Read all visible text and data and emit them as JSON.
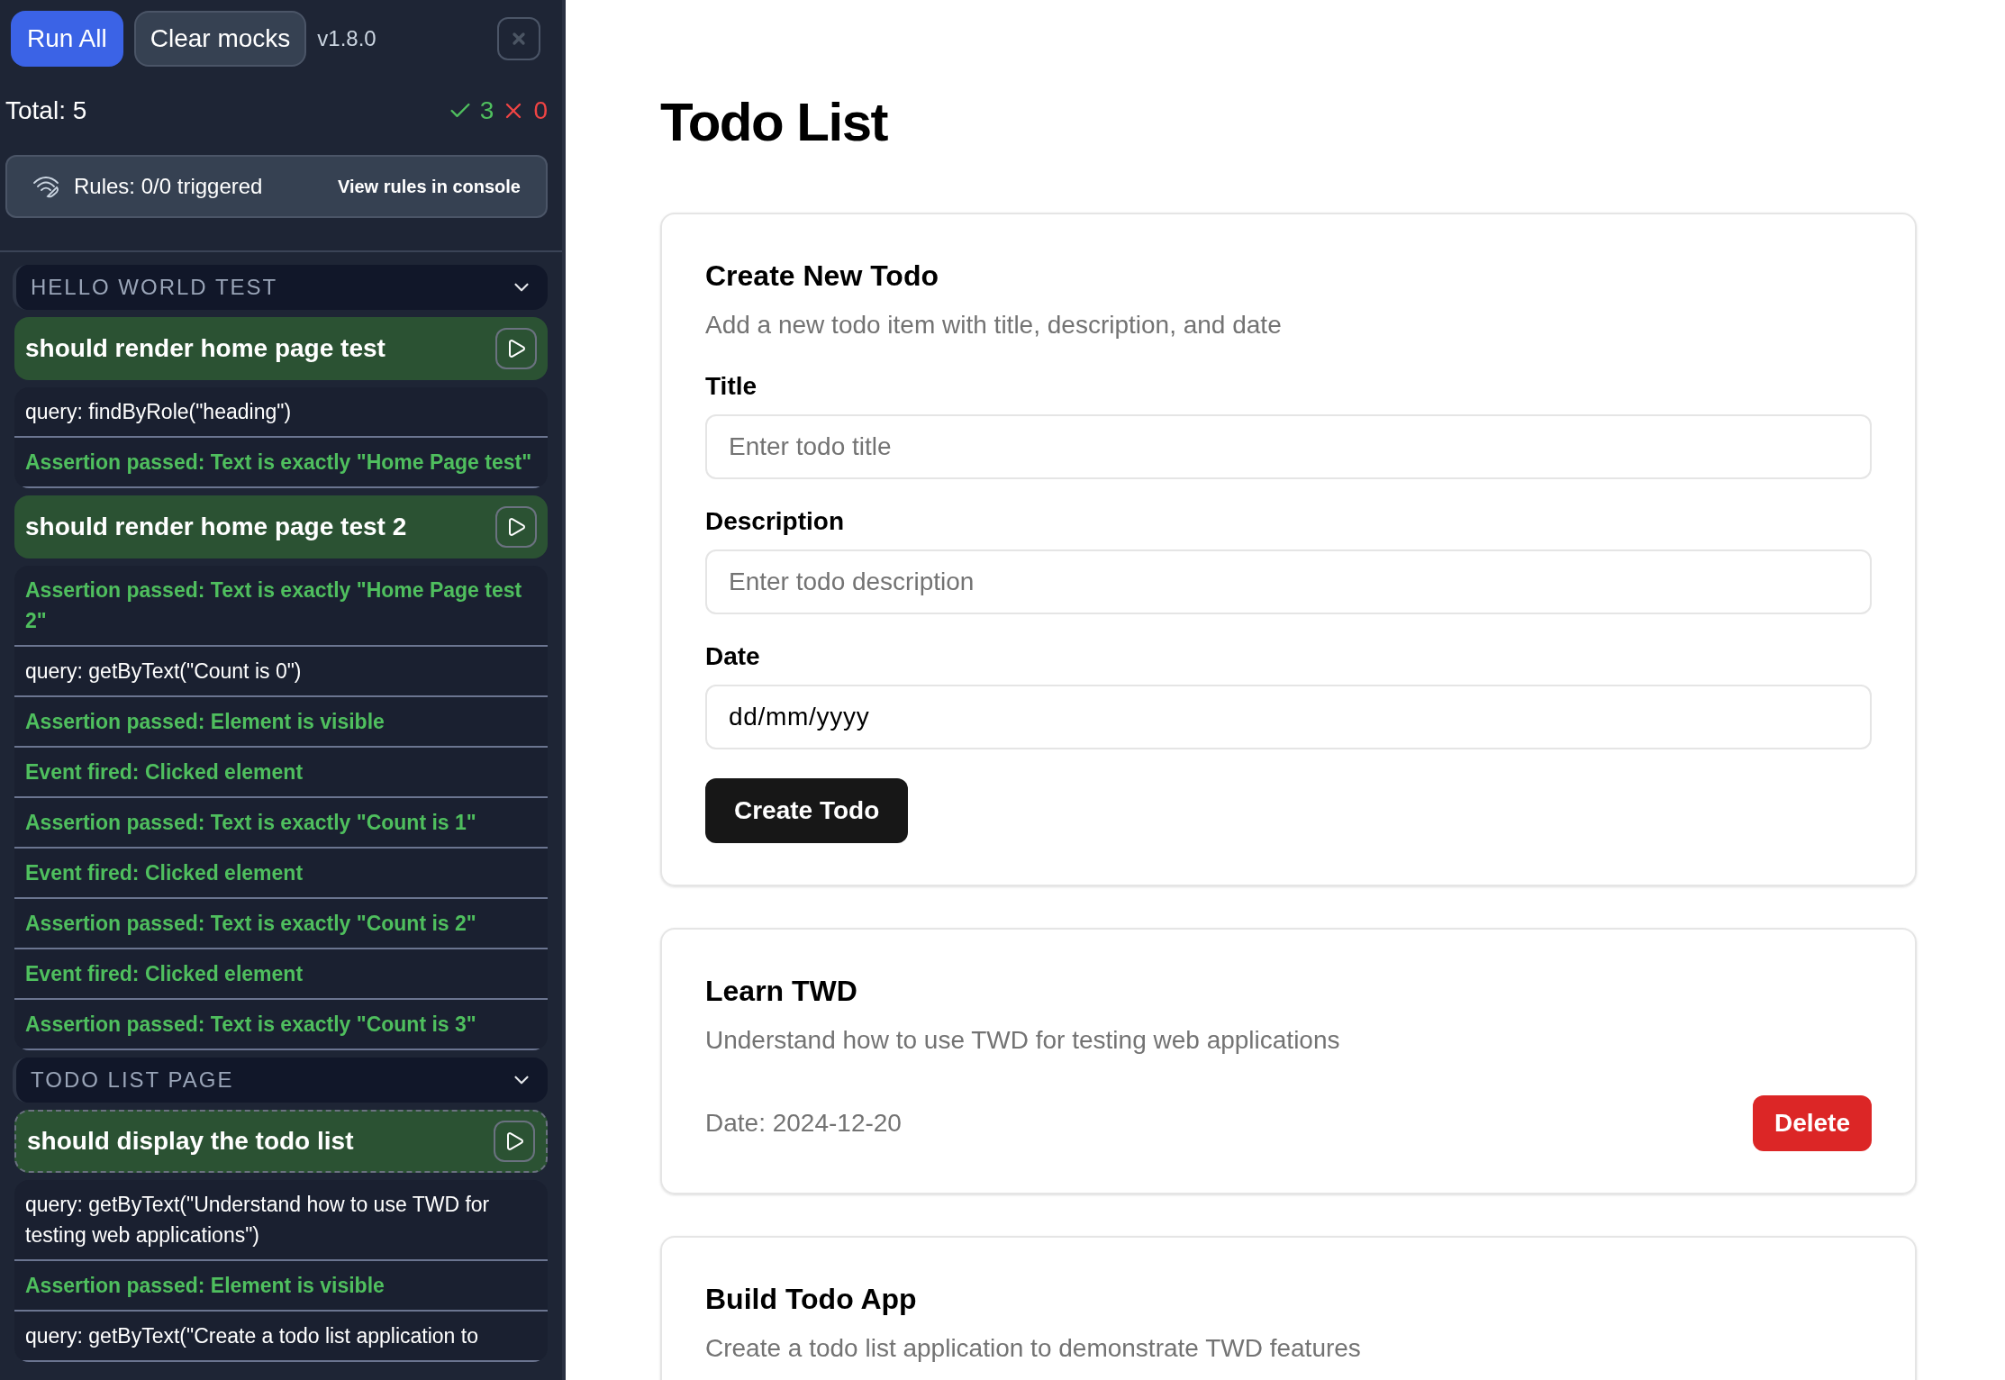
{
  "sidebar": {
    "buttons": [
      {
        "label": "Run All",
        "kind": "primary"
      },
      {
        "label": "Clear mocks",
        "kind": "secondary"
      }
    ],
    "version": "v1.8.0",
    "total": "Total: 5",
    "passed": "3",
    "failed": "0",
    "rules": {
      "label": "Rules: 0/0 triggered",
      "link": "View rules in console"
    },
    "groups": [
      {
        "title": "HELLO WORLD TEST",
        "expanded": true,
        "tests": [
          {
            "name": "should render home page test",
            "passed": true,
            "selected": false,
            "steps": [
              {
                "kind": "query",
                "text": "query: findByRole(\"heading\")"
              },
              {
                "kind": "assertion",
                "text": "Assertion passed: Text is exactly \"Home Page test\""
              }
            ]
          },
          {
            "name": "should render home page test 2",
            "passed": true,
            "selected": false,
            "steps": [
              {
                "kind": "assertion",
                "text": "Assertion passed: Text is exactly \"Home Page test 2\""
              },
              {
                "kind": "query",
                "text": "query: getByText(\"Count is 0\")"
              },
              {
                "kind": "assertion",
                "text": "Assertion passed: Element is visible"
              },
              {
                "kind": "event",
                "text": "Event fired: Clicked element"
              },
              {
                "kind": "assertion",
                "text": "Assertion passed: Text is exactly \"Count is 1\""
              },
              {
                "kind": "event",
                "text": "Event fired: Clicked element"
              },
              {
                "kind": "assertion",
                "text": "Assertion passed: Text is exactly \"Count is 2\""
              },
              {
                "kind": "event",
                "text": "Event fired: Clicked element"
              },
              {
                "kind": "assertion",
                "text": "Assertion passed: Text is exactly \"Count is 3\""
              }
            ]
          }
        ]
      },
      {
        "title": "TODO LIST PAGE",
        "expanded": true,
        "tests": [
          {
            "name": "should display the todo list",
            "passed": true,
            "selected": true,
            "steps": [
              {
                "kind": "query",
                "text": "query: getByText(\"Understand how to use TWD for testing web applications\")"
              },
              {
                "kind": "assertion",
                "text": "Assertion passed: Element is visible"
              },
              {
                "kind": "query",
                "text": "query: getByText(\"Create a todo list application to"
              }
            ]
          }
        ]
      }
    ]
  },
  "main": {
    "title": "Todo List",
    "form": {
      "title": "Create New Todo",
      "subtitle": "Add a new todo item with title, description, and date",
      "fields": [
        {
          "label": "Title",
          "placeholder": "Enter todo title"
        },
        {
          "label": "Description",
          "placeholder": "Enter todo description"
        },
        {
          "label": "Date",
          "value": "dd/mm/yyyy"
        }
      ],
      "submit": "Create Todo"
    },
    "todos": [
      {
        "title": "Learn TWD",
        "description": "Understand how to use TWD for testing web applications",
        "date": "Date: 2024-12-20",
        "delete": "Delete"
      },
      {
        "title": "Build Todo App",
        "description": "Create a todo list application to demonstrate TWD features"
      }
    ]
  }
}
